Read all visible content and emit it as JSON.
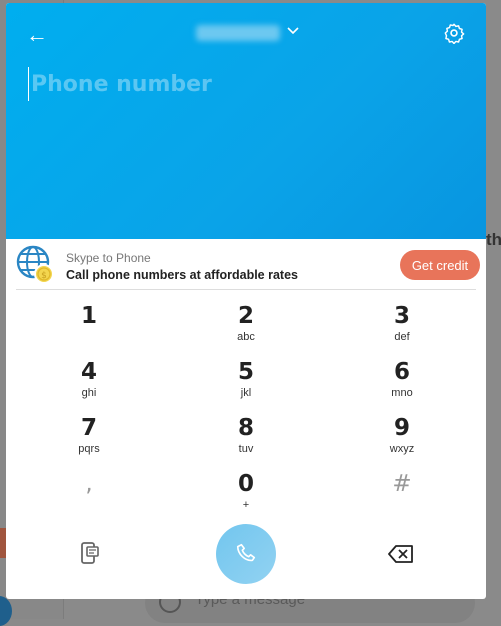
{
  "background": {
    "compose_placeholder": "Type a message",
    "partial_heading": "th"
  },
  "header": {
    "back_icon": "arrow-left-icon",
    "country_selector_icon": "chevron-down-icon",
    "settings_icon": "gear-icon",
    "phone_placeholder": "Phone number",
    "gradient": [
      "#00aeef",
      "#0895e0"
    ]
  },
  "promo": {
    "title": "Skype to Phone",
    "subtitle": "Call phone numbers at affordable rates",
    "button": "Get credit",
    "button_color": "#e8745a"
  },
  "keypad": [
    {
      "digit": "1",
      "letters": ""
    },
    {
      "digit": "2",
      "letters": "abc"
    },
    {
      "digit": "3",
      "letters": "def"
    },
    {
      "digit": "4",
      "letters": "ghi"
    },
    {
      "digit": "5",
      "letters": "jkl"
    },
    {
      "digit": "6",
      "letters": "mno"
    },
    {
      "digit": "7",
      "letters": "pqrs"
    },
    {
      "digit": "8",
      "letters": "tuv"
    },
    {
      "digit": "9",
      "letters": "wxyz"
    },
    {
      "digit": ",",
      "letters": ""
    },
    {
      "digit": "0",
      "letters": "+"
    },
    {
      "digit": "#",
      "letters": ""
    }
  ],
  "actions": {
    "sms_icon": "sms-phone-icon",
    "call_icon": "phone-icon",
    "call_color": "#7fcbf0",
    "backspace_icon": "backspace-icon"
  }
}
